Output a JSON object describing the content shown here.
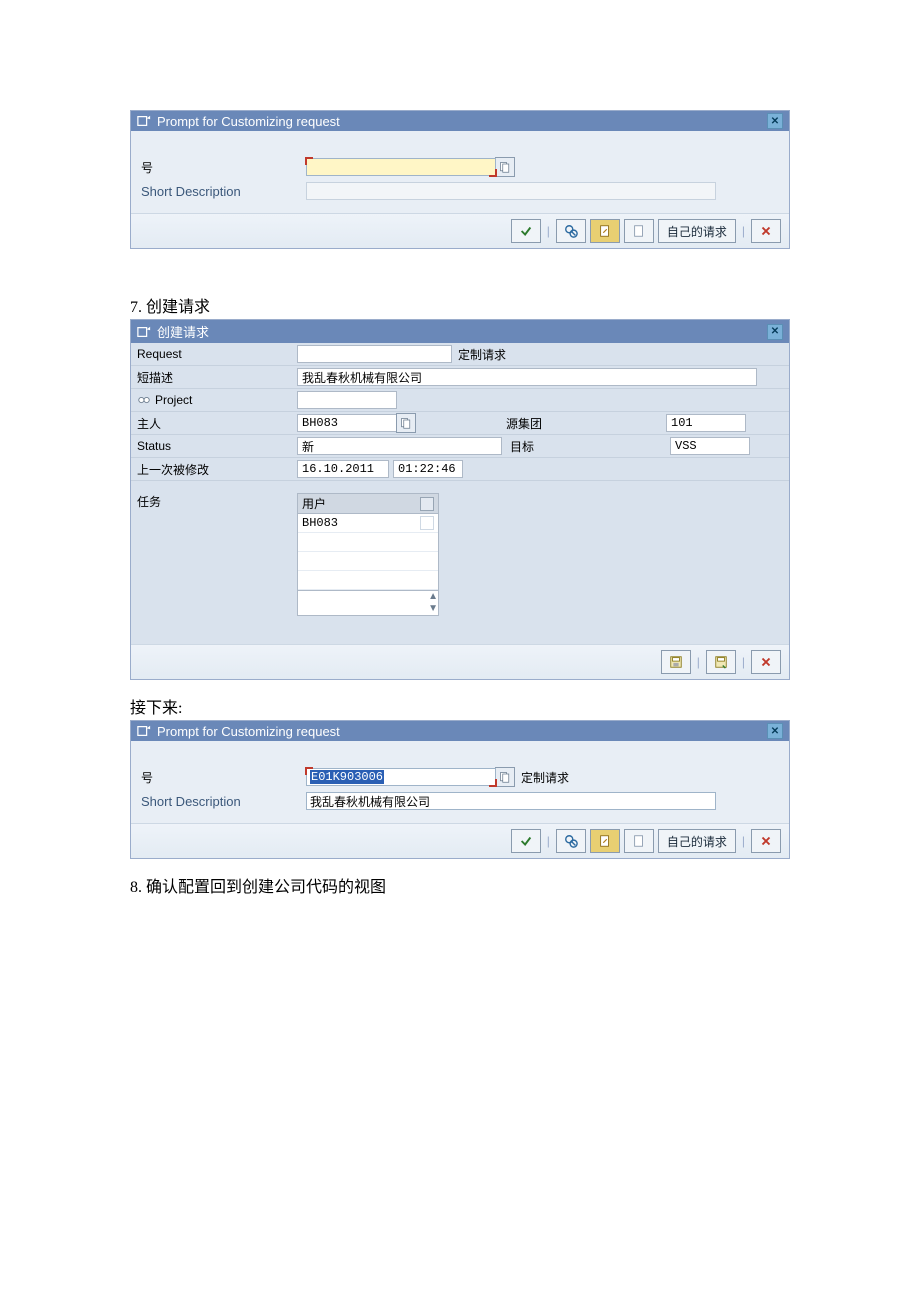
{
  "dialog1": {
    "title": "Prompt for Customizing request",
    "label_number": "号",
    "label_short_desc": "Short Description",
    "number_value": "",
    "short_desc_value": "",
    "btn_own_requests": "自己的请求"
  },
  "sect7": "7.    创建请求",
  "dialog2": {
    "title": "创建请求",
    "row_request": "Request",
    "val_request_type": "定制请求",
    "row_shortdesc": "短描述",
    "val_shortdesc": "我乱春秋机械有限公司",
    "row_project": "Project",
    "row_owner": "主人",
    "val_owner": "BH083",
    "lbl_source": "源集团",
    "val_source": "101",
    "row_status": "Status",
    "val_status": "新",
    "lbl_target": "目标",
    "val_target": "VSS",
    "row_lastchanged": "上一次被修改",
    "val_date": "16.10.2011",
    "val_time": "01:22:46",
    "row_tasks": "任务",
    "tasks_header": "用户",
    "tasks_user": "BH083"
  },
  "next_label": "接下来:",
  "dialog3": {
    "title": "Prompt for Customizing request",
    "label_number": "号",
    "number_value": "E01K903006",
    "label_type": "定制请求",
    "label_short_desc": "Short Description",
    "short_desc_value": "我乱春秋机械有限公司",
    "btn_own_requests": "自己的请求"
  },
  "sect8": "8.    确认配置回到创建公司代码的视图"
}
